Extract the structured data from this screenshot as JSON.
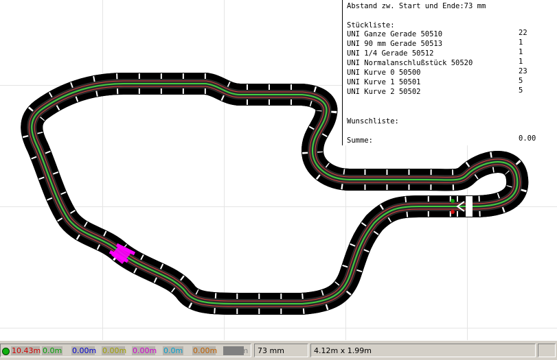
{
  "parts_list": {
    "distance_line": "Abstand zw. Start und Ende:73 mm",
    "heading": "Stückliste:",
    "items": [
      {
        "name": "UNI Ganze Gerade 50510",
        "qty": "22"
      },
      {
        "name": "UNI 90 mm Gerade 50513",
        "qty": "1"
      },
      {
        "name": "UNI 1/4 Gerade 50512",
        "qty": "1"
      },
      {
        "name": "UNI Normalanschlußstück 50520",
        "qty": "1"
      },
      {
        "name": "UNI Kurve 0 50500",
        "qty": "23"
      },
      {
        "name": "UNI Kurve 1 50501",
        "qty": "5"
      },
      {
        "name": "UNI Kurve 2 50502",
        "qty": "5"
      }
    ],
    "wish_heading": "Wunschliste:",
    "sum_label": "Summe:",
    "sum_value": "0.00"
  },
  "status": {
    "lanes": [
      {
        "value": "10.43m",
        "color": "#d00000"
      },
      {
        "value": "0.0m",
        "color": "#00a000"
      },
      {
        "value": "0.00m",
        "color": "#0000d0"
      },
      {
        "value": "0.00m",
        "color": "#a0a000"
      },
      {
        "value": "0.00m",
        "color": "#d000d0"
      },
      {
        "value": "0.0m",
        "color": "#00a0d0"
      },
      {
        "value": "0.00m",
        "color": "#c06000"
      },
      {
        "value": "0.00m",
        "color": "#808080"
      }
    ],
    "gap": "73 mm",
    "dimensions": "4.12m x 1.99m"
  },
  "colors": {
    "track": "#222222",
    "rail_outer": "#e04040",
    "rail_inner": "#40d040",
    "marker": "#ff00ff"
  }
}
